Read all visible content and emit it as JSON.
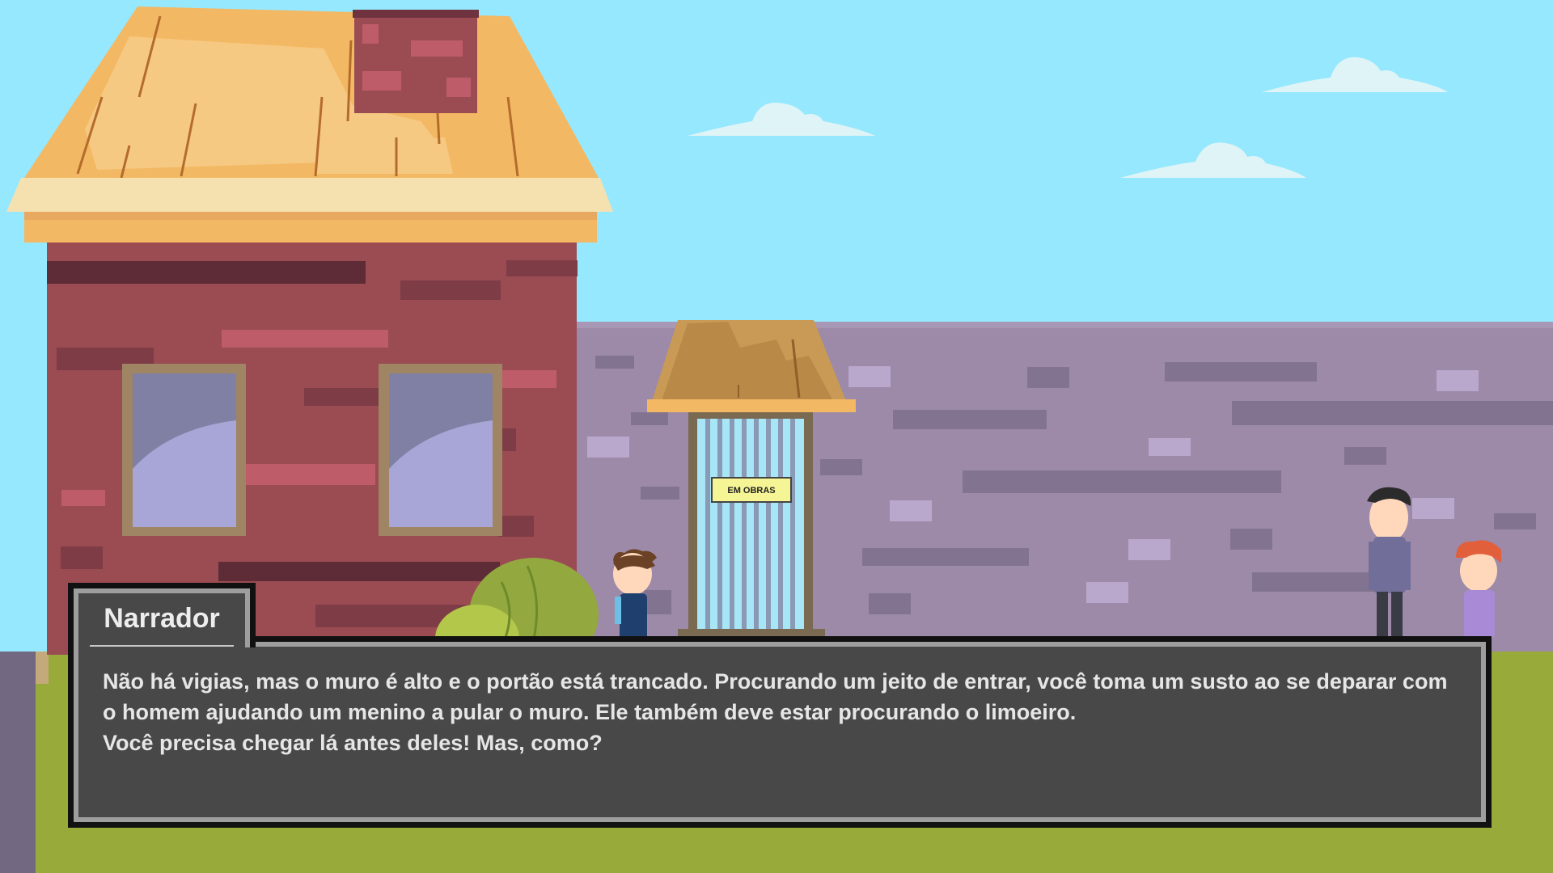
{
  "scene": {
    "name": "house-wall-gate",
    "sign_text": "EM OBRAS",
    "colors": {
      "sky": "#96e8ff",
      "grass": "#97aa3a",
      "wall": "#9c8aa8",
      "house_brick": "#9a4c52",
      "roof": "#f3b863",
      "dialog_bg": "#484848"
    }
  },
  "characters": [
    {
      "id": "boy",
      "position_label": "near gate"
    },
    {
      "id": "man",
      "position_label": "by wall"
    },
    {
      "id": "redhead-boy",
      "position_label": "right edge"
    }
  ],
  "dialog": {
    "speaker": "Narrador",
    "text": "Não há vigias, mas o muro é alto e o portão está trancado. Procurando um jeito de entrar, você toma um susto ao se deparar com o homem ajudando um menino a pular o muro. Ele também deve estar procurando o limoeiro.\nVocê precisa chegar lá antes deles! Mas, como?"
  }
}
